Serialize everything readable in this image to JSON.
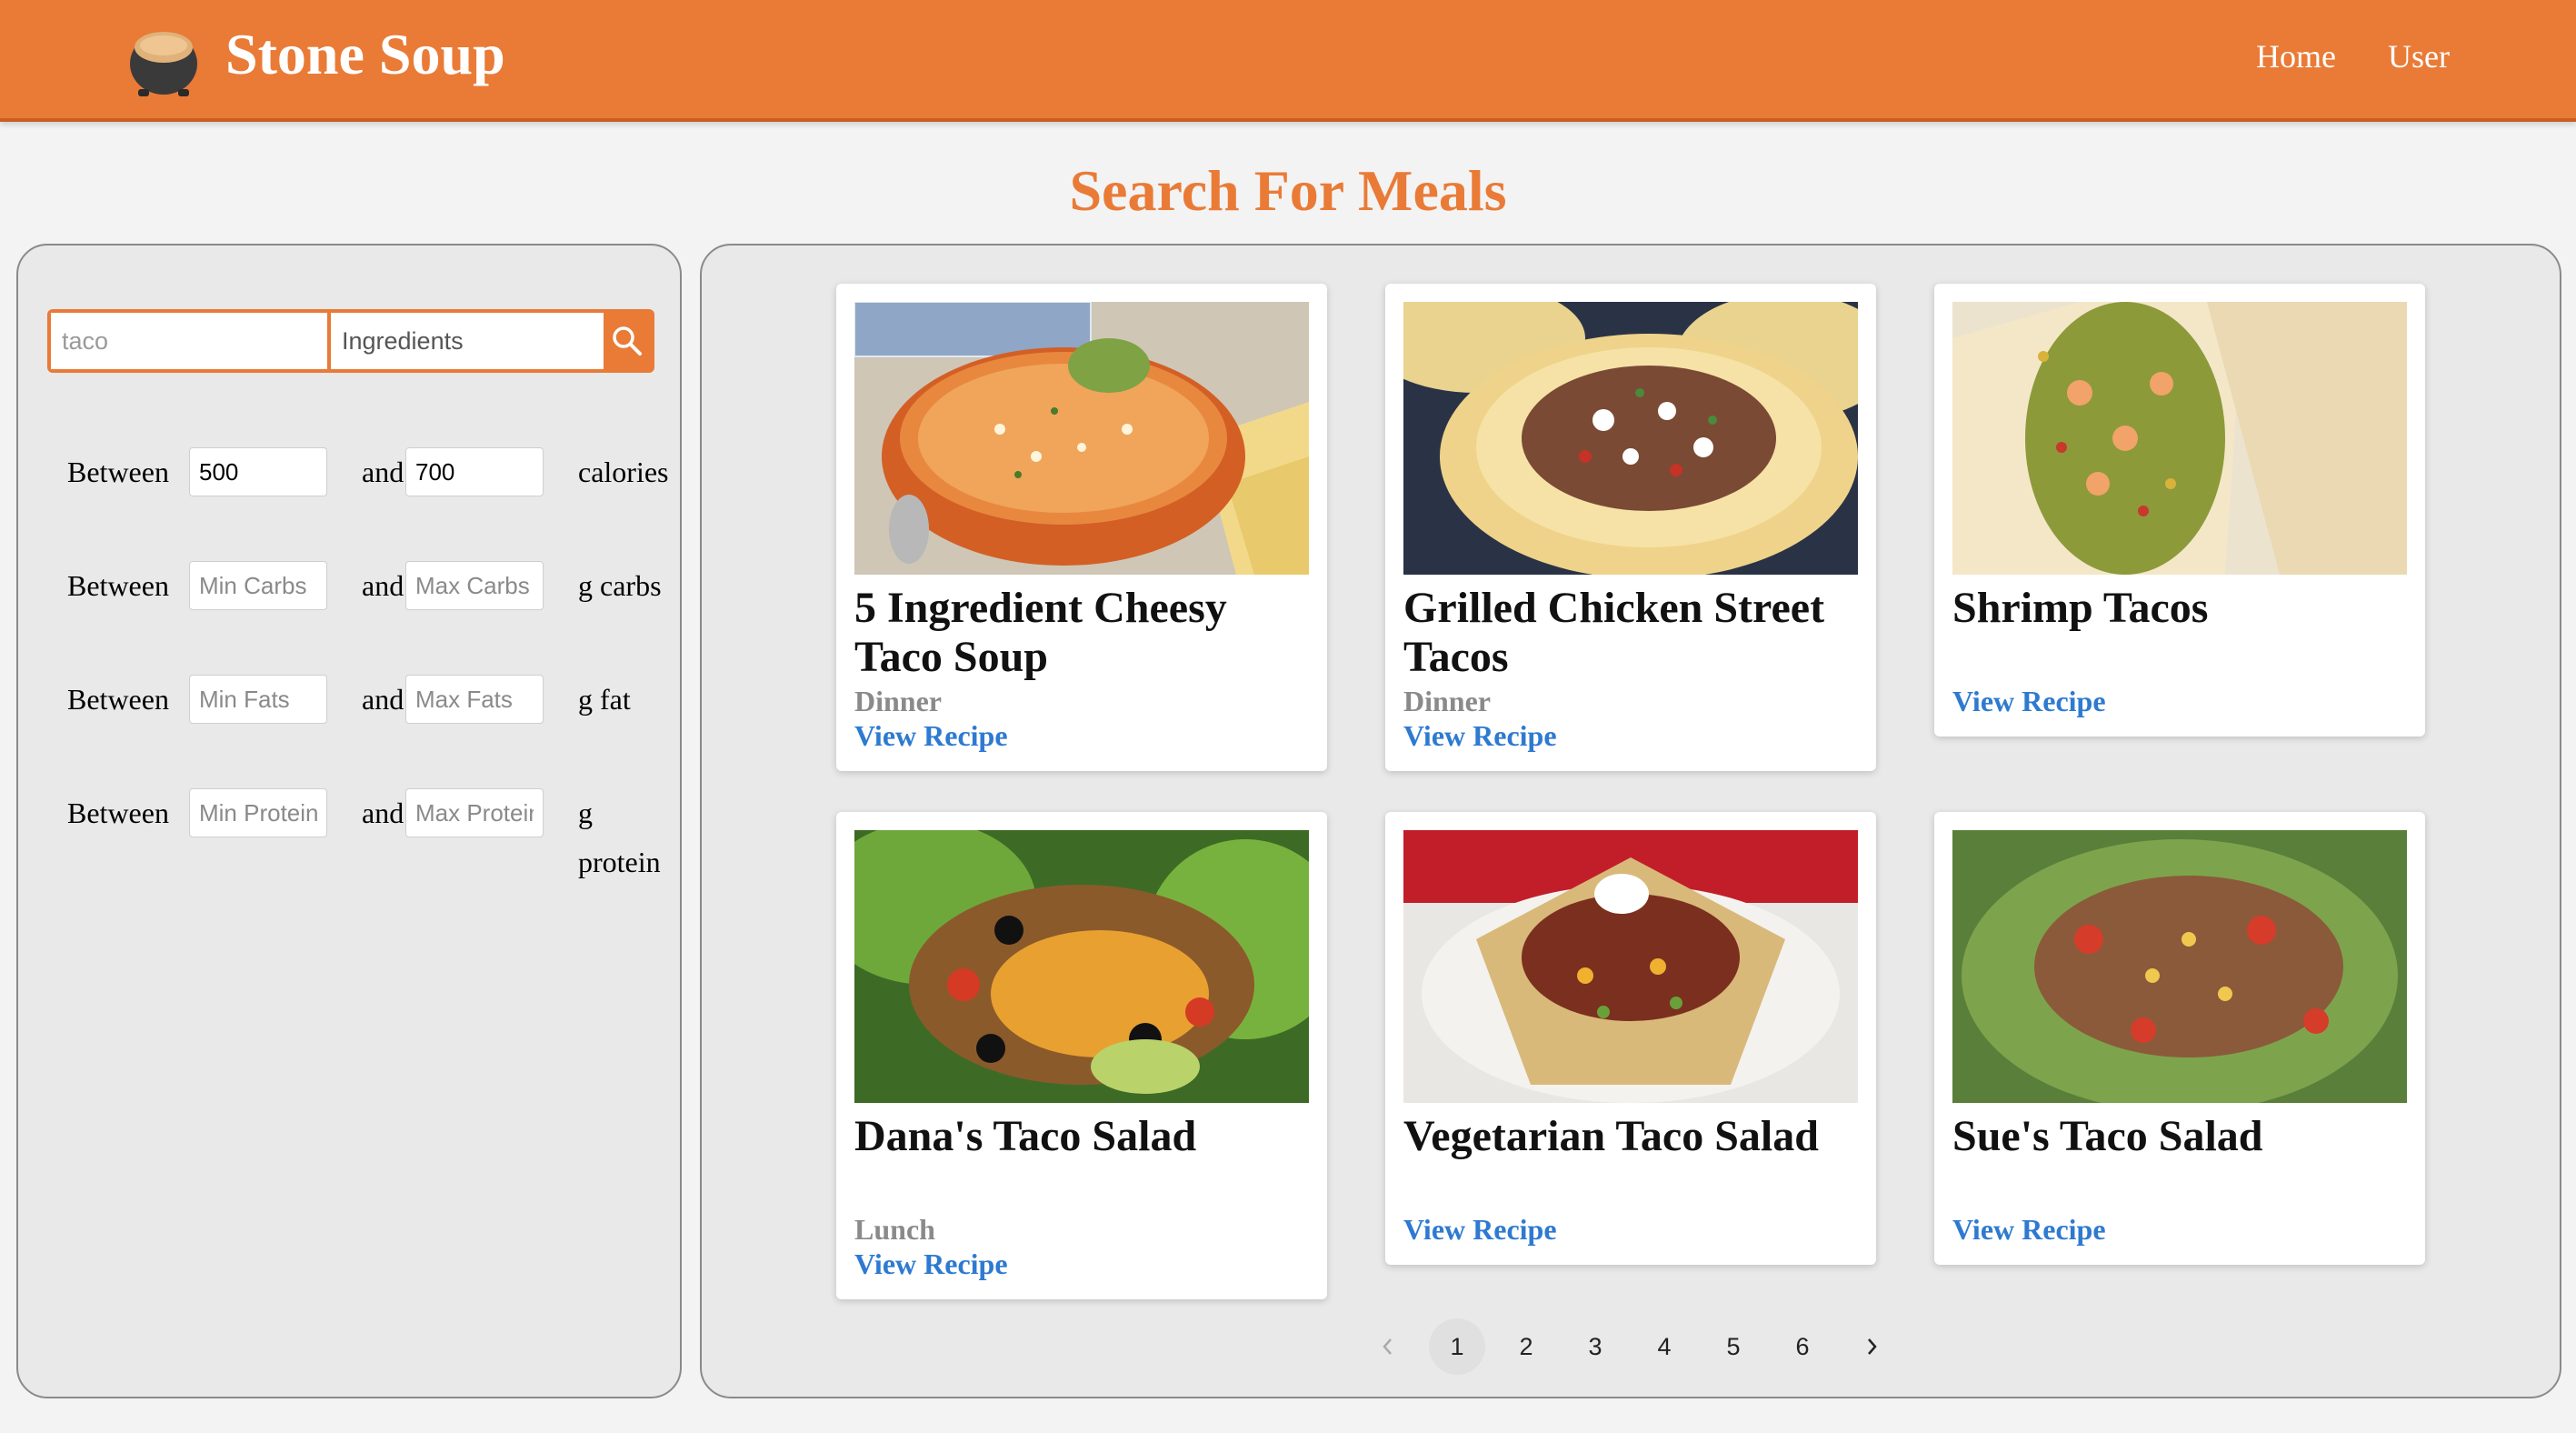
{
  "header": {
    "brand": "Stone Soup",
    "nav": {
      "home": "Home",
      "user": "User"
    }
  },
  "page_title": "Search For Meals",
  "filters": {
    "search": {
      "query_value": "",
      "query_placeholder": "taco",
      "type_placeholder": "Ingredients"
    },
    "rows": [
      {
        "between": "Between",
        "and": "and",
        "min_value": "500",
        "min_placeholder": "",
        "max_value": "700",
        "max_placeholder": "",
        "unit": "calories"
      },
      {
        "between": "Between",
        "and": "and",
        "min_value": "",
        "min_placeholder": "Min Carbs",
        "max_value": "",
        "max_placeholder": "Max Carbs",
        "unit": "g carbs"
      },
      {
        "between": "Between",
        "and": "and",
        "min_value": "",
        "min_placeholder": "Min Fats",
        "max_value": "",
        "max_placeholder": "Max Fats",
        "unit": "g fat"
      },
      {
        "between": "Between",
        "and": "and",
        "min_value": "",
        "min_placeholder": "Min Protein",
        "max_value": "",
        "max_placeholder": "Max Protein",
        "unit": "g protein"
      }
    ]
  },
  "results": [
    {
      "title": "5 Ingredient Cheesy Taco Soup",
      "meal_type": "Dinner",
      "link": "View Recipe"
    },
    {
      "title": "Grilled Chicken Street Tacos",
      "meal_type": "Dinner",
      "link": "View Recipe"
    },
    {
      "title": "Shrimp Tacos",
      "meal_type": "",
      "link": "View Recipe"
    },
    {
      "title": "Dana's Taco Salad",
      "meal_type": "Lunch",
      "link": "View Recipe"
    },
    {
      "title": "Vegetarian Taco Salad",
      "meal_type": "",
      "link": "View Recipe"
    },
    {
      "title": "Sue's Taco Salad",
      "meal_type": "",
      "link": "View Recipe"
    }
  ],
  "pagination": {
    "pages": [
      "1",
      "2",
      "3",
      "4",
      "5",
      "6"
    ],
    "current": "1",
    "prev_icon": "chevron-left-icon",
    "next_icon": "chevron-right-icon"
  },
  "colors": {
    "brand": "#e97b37",
    "link": "#2e7ad1",
    "muted": "#8a8a8a"
  }
}
